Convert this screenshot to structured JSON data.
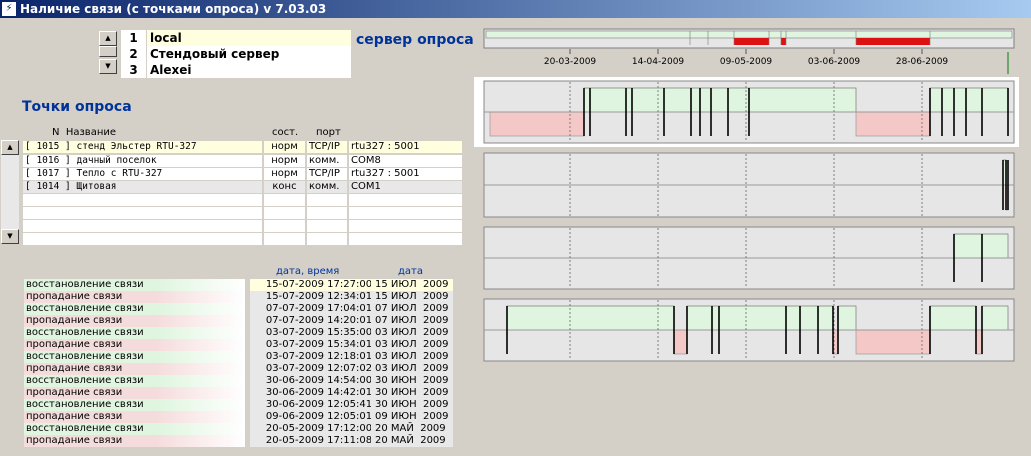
{
  "window": {
    "title": "Наличие связи (с точками опроса)  v 7.03.03",
    "icon": "app-icon"
  },
  "servers": {
    "title": "сервер опроса",
    "rows": [
      {
        "num": "1",
        "name": "local"
      },
      {
        "num": "2",
        "name": "Стендовый сервер"
      },
      {
        "num": "3",
        "name": "Alexei"
      }
    ]
  },
  "points": {
    "title": "Точки опроса",
    "headers": {
      "num_name": "N  Название",
      "state": "сост.",
      "port": "порт"
    },
    "rows": [
      {
        "name": "[ 1015 ] стенд Эльстер RTU-327",
        "state": "норм",
        "port": "TCP/IP",
        "addr": "rtu327 : 5001"
      },
      {
        "name": "[ 1016 ] дачный поселок",
        "state": "норм",
        "port": "комм.",
        "addr": "COM8"
      },
      {
        "name": "[ 1017 ] Тепло с RTU-327",
        "state": "норм",
        "port": "TCP/IP",
        "addr": "rtu327 : 5001"
      },
      {
        "name": "[ 1014 ] Щитовая",
        "state": "конс",
        "port": "комм.",
        "addr": "COM1"
      }
    ]
  },
  "events": {
    "headers": {
      "datetime": "дата, время",
      "date": "дата"
    },
    "rows": [
      {
        "type": "восстановление связи",
        "dt": "15-07-2009 17:27:00",
        "d": "15 ИЮЛ  2009"
      },
      {
        "type": "пропадание связи",
        "dt": "15-07-2009 12:34:01",
        "d": "15 ИЮЛ  2009"
      },
      {
        "type": "восстановление связи",
        "dt": "07-07-2009 17:04:01",
        "d": "07 ИЮЛ  2009"
      },
      {
        "type": "пропадание связи",
        "dt": "07-07-2009 14:20:01",
        "d": "07 ИЮЛ  2009"
      },
      {
        "type": "восстановление связи",
        "dt": "03-07-2009 15:35:00",
        "d": "03 ИЮЛ  2009"
      },
      {
        "type": "пропадание связи",
        "dt": "03-07-2009 15:34:01",
        "d": "03 ИЮЛ  2009"
      },
      {
        "type": "восстановление связи",
        "dt": "03-07-2009 12:18:01",
        "d": "03 ИЮЛ  2009"
      },
      {
        "type": "пропадание связи",
        "dt": "03-07-2009 12:07:02",
        "d": "03 ИЮЛ  2009"
      },
      {
        "type": "восстановление связи",
        "dt": "30-06-2009 14:54:00",
        "d": "30 ИЮН  2009"
      },
      {
        "type": "пропадание связи",
        "dt": "30-06-2009 14:42:01",
        "d": "30 ИЮН  2009"
      },
      {
        "type": "восстановление связи",
        "dt": "30-06-2009 12:05:41",
        "d": "30 ИЮН  2009"
      },
      {
        "type": "пропадание связи",
        "dt": "09-06-2009 12:05:01",
        "d": "09 ИЮН  2009"
      },
      {
        "type": "восстановление связи",
        "dt": "20-05-2009 17:12:00",
        "d": "20 МАЙ  2009"
      },
      {
        "type": "пропадание связи",
        "dt": "20-05-2009 17:11:08",
        "d": "20 МАЙ  2009"
      }
    ]
  },
  "timeline": {
    "date_labels": [
      "20-03-2009",
      "14-04-2009",
      "09-05-2009",
      "03-06-2009",
      "28-06-2009"
    ],
    "colors": {
      "up": "#dff5df",
      "down": "#f5c8c8",
      "server_down": "#dd1111",
      "grid": "#888888",
      "event": "#000000"
    }
  }
}
